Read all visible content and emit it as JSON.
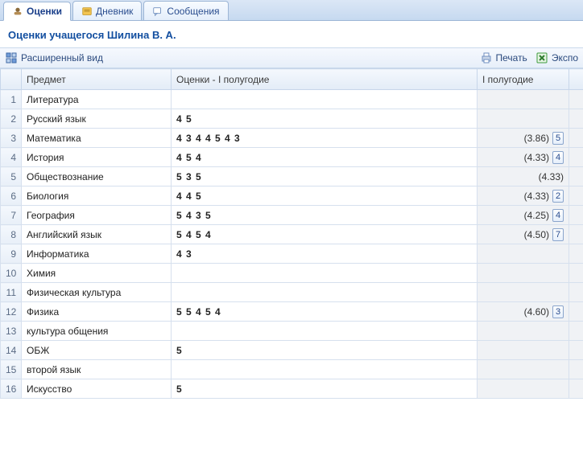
{
  "tabs": [
    {
      "label": "Оценки",
      "active": true
    },
    {
      "label": "Дневник",
      "active": false
    },
    {
      "label": "Сообщения",
      "active": false
    }
  ],
  "page_title": "Оценки учащегося Шилина В. А.",
  "toolbar": {
    "expanded_view": "Расширенный вид",
    "print": "Печать",
    "export": "Экспо"
  },
  "columns": {
    "subject": "Предмет",
    "grades": "Оценки - I полугодие",
    "term": "I полугодие"
  },
  "rows": [
    {
      "n": "1",
      "subject": "Литература",
      "grades": "",
      "avg": "",
      "final": ""
    },
    {
      "n": "2",
      "subject": "Русский язык",
      "grades": "4 5",
      "avg": "",
      "final": ""
    },
    {
      "n": "3",
      "subject": "Математика",
      "grades": "4 3 4 4 5 4 3",
      "avg": "(3.86)",
      "final": "5"
    },
    {
      "n": "4",
      "subject": "История",
      "grades": "4 5 4",
      "avg": "(4.33)",
      "final": "4"
    },
    {
      "n": "5",
      "subject": "Обществознание",
      "grades": "5 3 5",
      "avg": "(4.33)",
      "final": ""
    },
    {
      "n": "6",
      "subject": "Биология",
      "grades": "4 4 5",
      "avg": "(4.33)",
      "final": "2"
    },
    {
      "n": "7",
      "subject": "География",
      "grades": "5 4 3 5",
      "avg": "(4.25)",
      "final": "4"
    },
    {
      "n": "8",
      "subject": "Английский язык",
      "grades": "5 4 5 4",
      "avg": "(4.50)",
      "final": "7"
    },
    {
      "n": "9",
      "subject": "Информатика",
      "grades": "4 3",
      "avg": "",
      "final": ""
    },
    {
      "n": "10",
      "subject": "Химия",
      "grades": "",
      "avg": "",
      "final": ""
    },
    {
      "n": "11",
      "subject": "Физическая культура",
      "grades": "",
      "avg": "",
      "final": ""
    },
    {
      "n": "12",
      "subject": "Физика",
      "grades": "5 5 4 5 4",
      "avg": "(4.60)",
      "final": "3"
    },
    {
      "n": "13",
      "subject": "культура общения",
      "grades": "",
      "avg": "",
      "final": ""
    },
    {
      "n": "14",
      "subject": "ОБЖ",
      "grades": "5",
      "avg": "",
      "final": ""
    },
    {
      "n": "15",
      "subject": "второй язык",
      "grades": "",
      "avg": "",
      "final": ""
    },
    {
      "n": "16",
      "subject": "Искусство",
      "grades": "5",
      "avg": "",
      "final": ""
    }
  ]
}
